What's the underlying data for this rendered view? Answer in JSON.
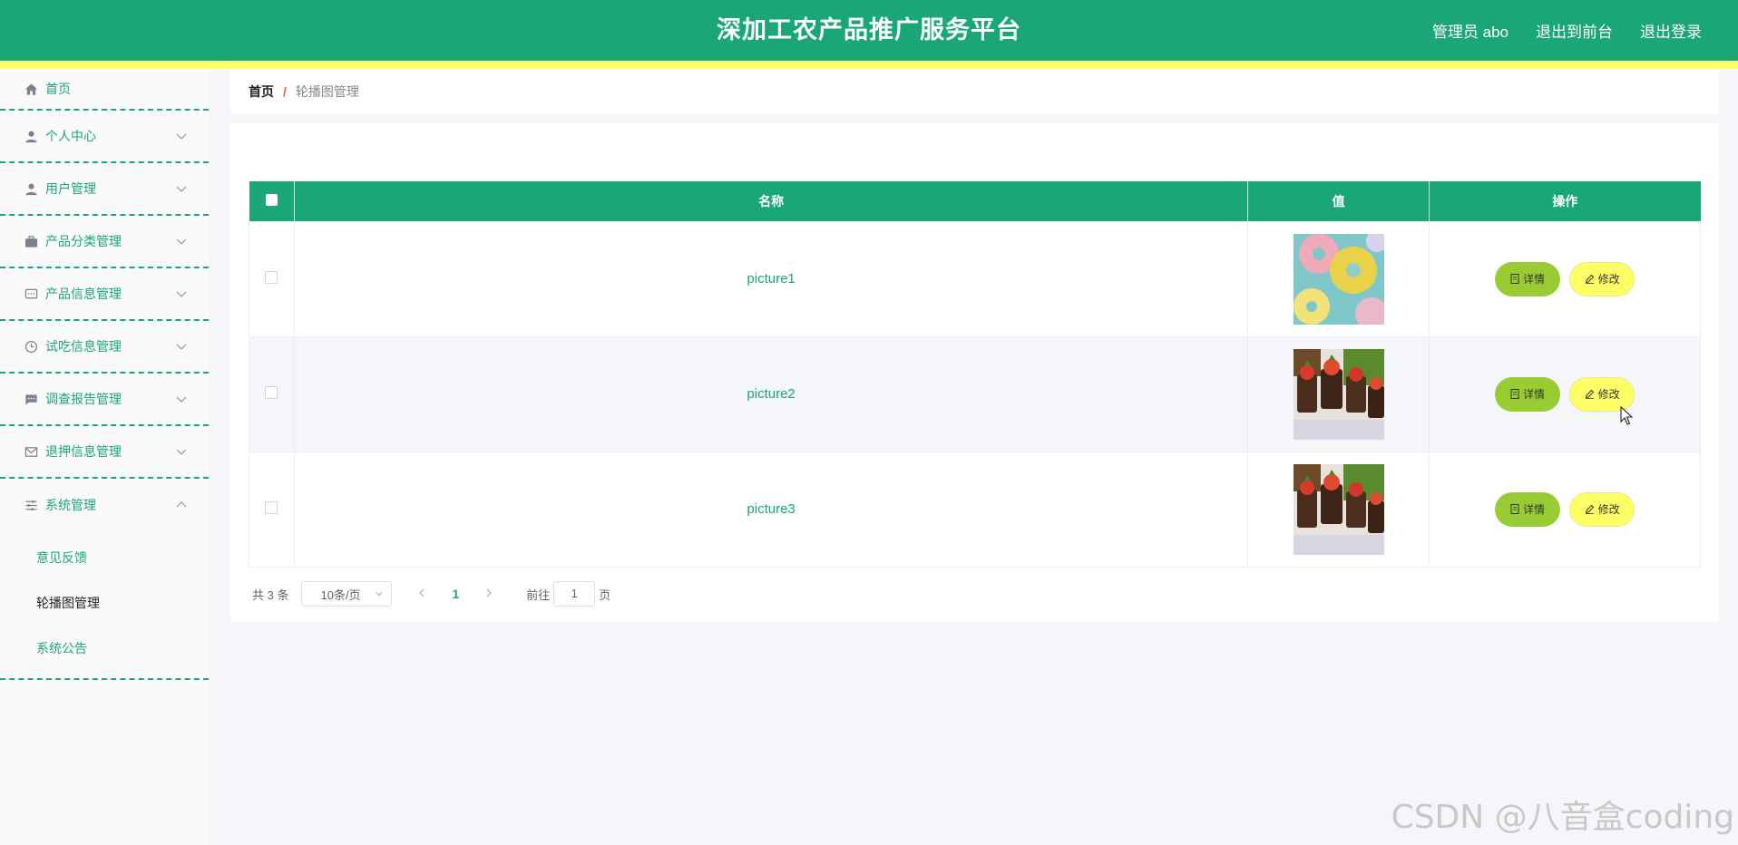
{
  "header": {
    "title": "深加工农产品推广服务平台",
    "user": "管理员 abo",
    "goto_front": "退出到前台",
    "logout": "退出登录",
    "colors": {
      "primary": "#1aa678",
      "stripe": "#ffff66"
    }
  },
  "sidebar": {
    "items": [
      {
        "label": "首页",
        "icon": "home-icon"
      },
      {
        "label": "个人中心",
        "icon": "user-icon"
      },
      {
        "label": "用户管理",
        "icon": "user-icon"
      },
      {
        "label": "产品分类管理",
        "icon": "briefcase-icon"
      },
      {
        "label": "产品信息管理",
        "icon": "chat-icon"
      },
      {
        "label": "试吃信息管理",
        "icon": "clock-icon"
      },
      {
        "label": "调查报告管理",
        "icon": "message-icon"
      },
      {
        "label": "退押信息管理",
        "icon": "mail-icon"
      },
      {
        "label": "系统管理",
        "icon": "sliders-icon"
      }
    ],
    "sub_items": [
      "意见反馈",
      "轮播图管理",
      "系统公告"
    ],
    "active_sub": "轮播图管理"
  },
  "breadcrumb": {
    "home": "首页",
    "separator": "/",
    "current": "轮播图管理"
  },
  "table": {
    "headers": {
      "name": "名称",
      "value": "值",
      "actions": "操作"
    },
    "rows": [
      {
        "name": "picture1",
        "image": "donut-photo"
      },
      {
        "name": "picture2",
        "image": "dessert-photo"
      },
      {
        "name": "picture3",
        "image": "dessert-photo"
      }
    ],
    "detail_label": "详情",
    "edit_label": "修改"
  },
  "pagination": {
    "total": "共 3 条",
    "page_size": "10条/页",
    "current_page": "1",
    "goto_prefix": "前往",
    "goto_value": "1",
    "goto_suffix": "页"
  },
  "watermark": "CSDN @八音盒coding"
}
